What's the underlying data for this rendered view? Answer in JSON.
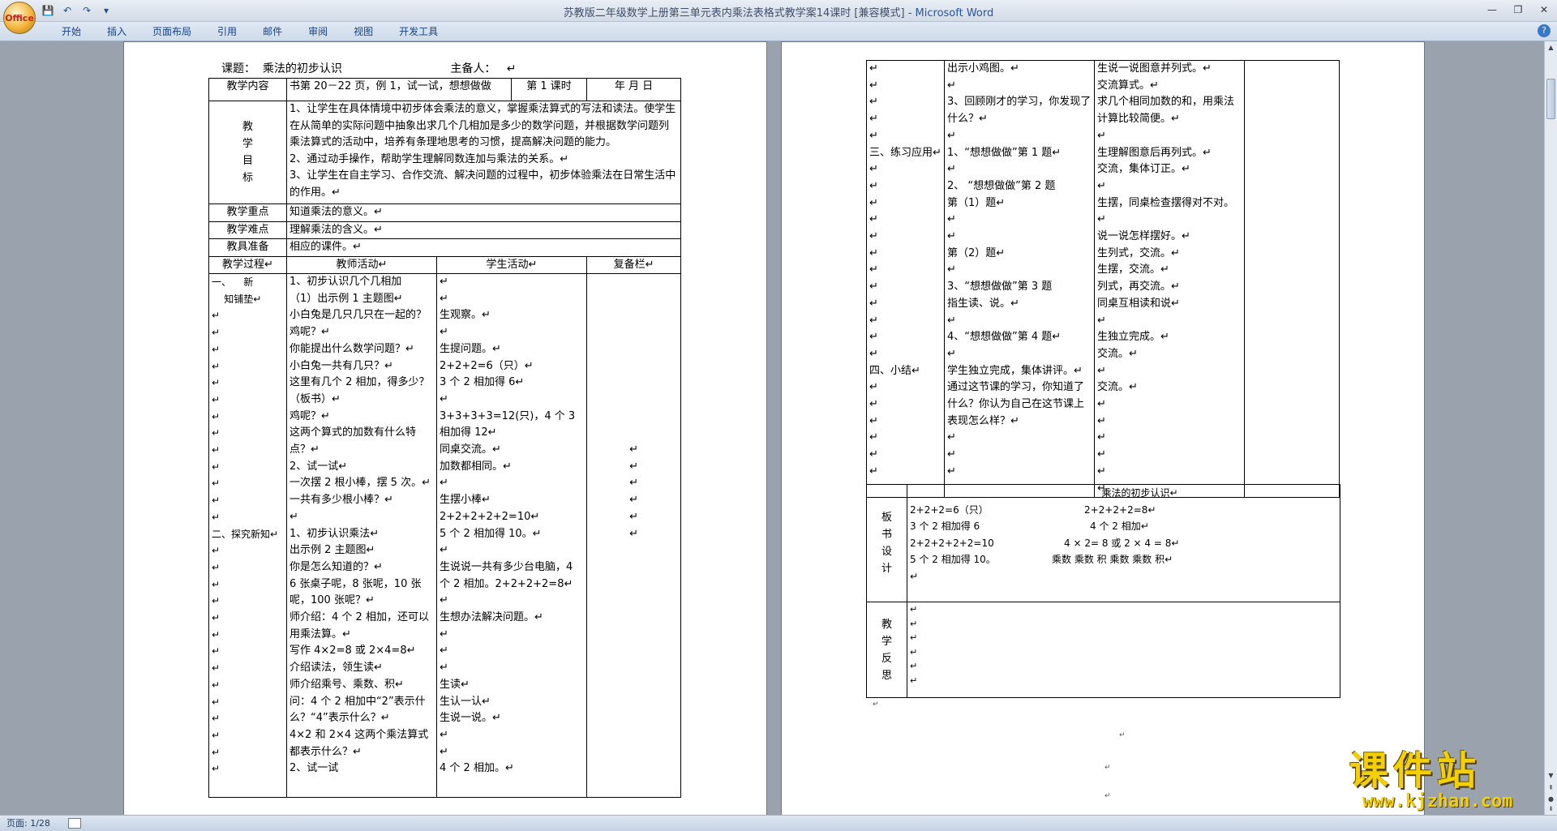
{
  "window": {
    "title": "苏教版二年级数学上册第三单元表内乘法表格式教学案14课时 [兼容模式]",
    "title_sep": " - ",
    "app_name": "Microsoft Word",
    "office_button_label": "Office",
    "minimize": "—",
    "restore": "❐",
    "close": "✕"
  },
  "quick_access": {
    "save": "💾",
    "undo": "↶",
    "redo": "↷",
    "customize": "▾"
  },
  "ribbon": {
    "tabs": [
      "开始",
      "插入",
      "页面布局",
      "引用",
      "邮件",
      "审阅",
      "视图",
      "开发工具"
    ],
    "help": "?"
  },
  "status": {
    "page": "页面: 1/28"
  },
  "left_page": {
    "header": "课题：  乘法的初步认识                              主备人：   ↵",
    "mark": "↵",
    "row1": {
      "label": "教学内容",
      "content": "书第 20－22 页，例 1，试一试，想想做做",
      "period": "第 1 课时",
      "date": "年   月   日"
    },
    "row2": {
      "label": "教\n学\n目\n标",
      "content": "1、让学生在具体情境中初步体会乘法的意义，掌握乘法算式的写法和读法。使学生在从简单的实际问题中抽象出求几个几相加是多少的数学问题，并根据数学问题列乘法算式的活动中，培养有条理地思考的习惯，提高解决问题的能力。\n2、通过动手操作，帮助学生理解同数连加与乘法的关系。↵\n3、让学生在自主学习、合作交流、解决问题的过程中，初步体验乘法在日常生活中的作用。↵"
    },
    "row3": {
      "label": "教学重点",
      "content": "知道乘法的意义。↵"
    },
    "row4": {
      "label": "教学难点",
      "content": "理解乘法的含义。↵"
    },
    "row5": {
      "label": "教具准备",
      "content": "相应的课件。↵"
    },
    "col_headers": {
      "process": "教学过程↵",
      "teacher": "教师活动↵",
      "student": "学生活动↵",
      "notes": "复备栏↵"
    },
    "body": {
      "process": "一、    新\n    知铺垫↵\n↵\n↵\n↵\n↵\n↵\n↵\n↵\n↵\n↵\n↵\n↵\n↵\n↵\n二、探究新知↵\n↵\n↵\n↵\n↵\n↵\n↵\n↵\n↵\n↵\n↵\n↵\n↵\n↵\n↵",
      "teacher": "1、初步认识几个几相加\n（1）出示例 1 主题图↵\n小白兔是几只几只在一起的？鸡呢？↵\n你能提出什么数学问题？↵\n小白兔一共有几只？↵\n这里有几个 2 相加，得多少？（板书）↵\n鸡呢？↵\n这两个算式的加数有什么特点？↵\n2、试一试↵\n一次摆 2 根小棒，摆 5 次。↵\n一共有多少根小棒？↵\n↵\n1、初步认识乘法↵\n出示例 2 主题图↵\n你是怎么知道的？↵\n6 张桌子呢，8 张呢，10 张呢，100 张呢？↵\n师介绍：4 个 2 相加，还可以用乘法算。↵\n写作 4×2=8 或 2×4=8↵\n介绍读法，领生读↵\n师介绍乘号、乘数、积↵\n问：4 个 2 相加中“2”表示什么？“4”表示什么？↵\n4×2 和 2×4 这两个乘法算式都表示什么？↵\n2、试一试",
      "student": "↵\n↵\n生观察。↵\n↵\n生提问题。↵\n2+2+2=6（只）↵\n3 个 2 相加得 6↵\n↵\n3+3+3+3=12(只)，4 个 3 相加得 12↵\n同桌交流。↵\n加数都相同。↵\n↵\n生摆小棒↵\n2+2+2+2+2=10↵\n5 个 2 相加得 10。↵\n↵\n生说说一共有多少台电脑，4 个 2 相加。2+2+2+2=8↵\n↵\n生想办法解决问题。↵\n↵\n↵\n↵\n生读↵\n生认一认↵\n生说一说。↵\n↵\n↵\n4 个 2 相加。↵",
      "notes": "\n\n\n\n\n\n\n\n\n\n↵\n↵\n↵\n↵\n↵\n↵"
    }
  },
  "right_page": {
    "top": {
      "process": "↵\n↵\n↵\n↵\n↵\n三、练习应用↵\n↵\n↵\n↵\n↵\n↵\n↵\n↵\n↵\n↵\n↵\n↵\n↵\n四、小结↵\n↵\n↵\n↵\n↵\n↵\n↵",
      "teacher": "出示小鸡图。↵\n↵\n3、回顾刚才的学习，你发现了什么？↵\n↵\n1、“想想做做”第 1 题↵\n↵\n2、 “想想做做”第 2 题\n第（1）题↵\n↵\n↵\n第（2）题↵\n↵\n3、“想想做做”第 3 题\n指生读、说。↵\n↵\n4、“想想做做”第 4 题↵\n↵\n学生独立完成，集体讲评。↵\n通过这节课的学习，你知道了什么？你认为自己在这节课上表现怎么样？↵\n↵\n↵\n↵",
      "student": "生说一说图意并列式。↵\n交流算式。↵\n求几个相同加数的和，用乘法计算比较简便。↵\n↵\n生理解图意后再列式。↵\n交流，集体订正。↵\n↵\n生摆，同桌检查摆得对不对。↵\n说一说怎样摆好。↵\n生列式，交流。↵\n生摆，交流。↵\n列式，再交流。↵\n同桌互相读和说↵\n↵\n生独立完成。↵\n交流。↵\n↵\n交流。↵\n↵\n↵\n↵\n↵\n↵\n↵",
      "notes": ""
    },
    "board": {
      "label": "板\n书\n设\n计",
      "title": "乘法的初步认识↵",
      "lines": [
        [
          "2+2+2=6（只）",
          "2+2+2+2=8↵"
        ],
        [
          "3 个 2 相加得 6",
          "4 个 2 相加↵"
        ],
        [
          "2+2+2+2+2=10",
          "4 × 2= 8 或 2 × 4 = 8↵"
        ],
        [
          "5 个 2 相加得 10。",
          "乘数 乘数 积  乘数 乘数 积↵"
        ]
      ],
      "tail": "↵"
    },
    "reflect": {
      "label": "教\n学\n反\n思",
      "content": "↵\n↵\n↵\n↵\n↵\n↵"
    },
    "after": "↵",
    "trail": [
      "↵",
      "↵",
      "↵"
    ]
  },
  "watermark": {
    "main": "课件站",
    "url": "www.kjzhan.com"
  }
}
